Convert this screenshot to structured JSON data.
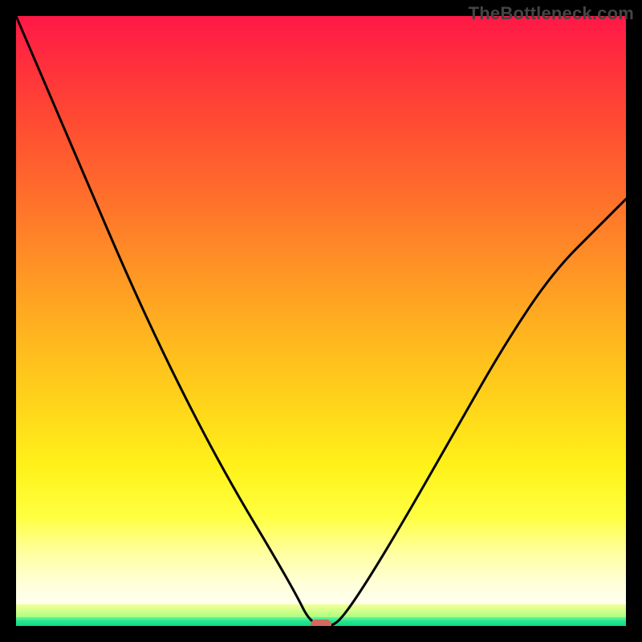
{
  "watermark": "TheBottleneck.com",
  "colors": {
    "frame": "#000000",
    "curve": "#000000",
    "marker": "#d26a5e",
    "gradient_top": "#ff1846",
    "gradient_bottom_green": "#0bdc86"
  },
  "chart_data": {
    "type": "line",
    "title": "",
    "xlabel": "",
    "ylabel": "",
    "xlim": [
      0,
      100
    ],
    "ylim": [
      0,
      100
    ],
    "grid": false,
    "legend": false,
    "notes": "V-shaped bottleneck curve over a red-to-green vertical gradient. Minimum (zero) around x≈50. A small rounded coral marker sits at the trough.",
    "series": [
      {
        "name": "bottleneck_curve",
        "x": [
          0,
          6,
          12,
          18,
          24,
          30,
          36,
          42,
          46,
          48,
          50,
          52,
          54,
          58,
          64,
          72,
          80,
          88,
          96,
          100
        ],
        "y": [
          100,
          86,
          72,
          58,
          45,
          33,
          22,
          12,
          5,
          1,
          0,
          0,
          2,
          8,
          18,
          32,
          46,
          58,
          66,
          70
        ]
      }
    ],
    "marker": {
      "x": 50,
      "y": 0
    }
  }
}
